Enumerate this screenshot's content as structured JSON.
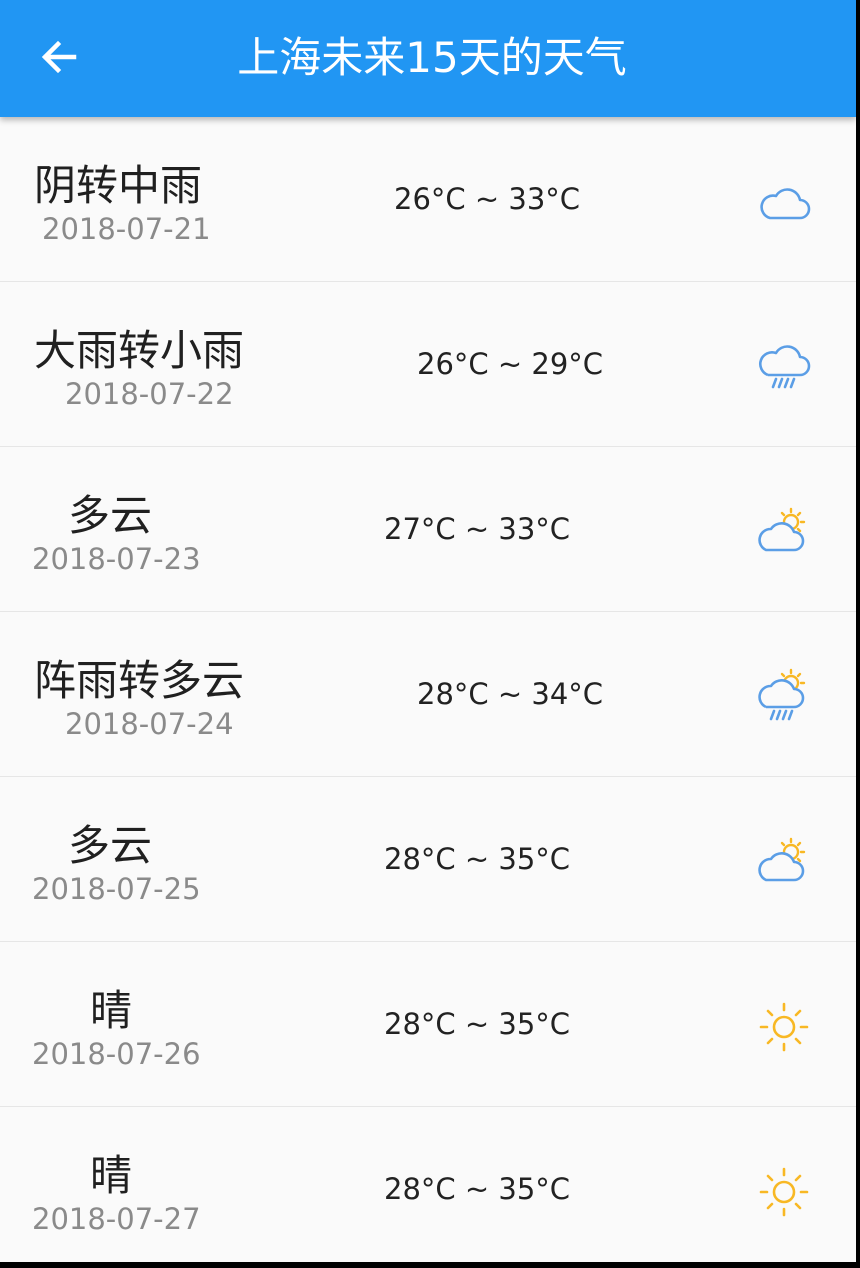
{
  "header": {
    "title": "上海未来15天的天气",
    "back_icon": "arrow-back-icon"
  },
  "colors": {
    "appbar": "#2196f3",
    "cloud_icon": "#5b9ee6",
    "sun_icon": "#f8b824",
    "date_text": "#8a8a8a"
  },
  "forecast": [
    {
      "weather": "阴转中雨",
      "date": "2018-07-21",
      "temp": "26°C ~ 33°C",
      "icon": "cloud-icon"
    },
    {
      "weather": "大雨转小雨",
      "date": "2018-07-22",
      "temp": "26°C ~ 29°C",
      "icon": "cloud-rain-icon"
    },
    {
      "weather": "多云",
      "date": "2018-07-23",
      "temp": "27°C ~ 33°C",
      "icon": "partly-cloudy-icon"
    },
    {
      "weather": "阵雨转多云",
      "date": "2018-07-24",
      "temp": "28°C ~ 34°C",
      "icon": "sun-cloud-rain-icon"
    },
    {
      "weather": "多云",
      "date": "2018-07-25",
      "temp": "28°C ~ 35°C",
      "icon": "partly-cloudy-icon"
    },
    {
      "weather": "晴",
      "date": "2018-07-26",
      "temp": "28°C ~ 35°C",
      "icon": "sun-icon"
    },
    {
      "weather": "晴",
      "date": "2018-07-27",
      "temp": "28°C ~ 35°C",
      "icon": "sun-icon"
    }
  ]
}
